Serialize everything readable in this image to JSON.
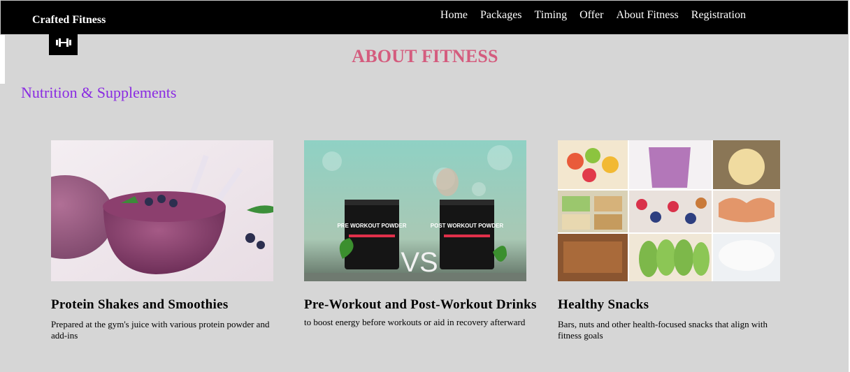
{
  "header": {
    "brand": "Crafted Fitness",
    "logo_icon": "dumbbell-icon",
    "nav": [
      "Home",
      "Packages",
      "Timing",
      "Offer",
      "About Fitness",
      "Registration"
    ]
  },
  "page": {
    "title": "ABOUT FITNESS",
    "section_title": "Nutrition & Supplements"
  },
  "cards": [
    {
      "title": "Protein Shakes and Smoothies",
      "description": "Prepared at the gym's juice with various protein powder and add-ins",
      "image": "purple-smoothie-image"
    },
    {
      "title": "Pre-Workout and Post-Workout Drinks",
      "description": "to boost energy before workouts or aid in recovery afterward",
      "image": "workout-powder-vs-image",
      "image_text": {
        "tub_left_title": "PRE WORKOUT POWDER",
        "tub_right_title": "POST WORKOUT POWDER",
        "vs": "VS"
      }
    },
    {
      "title": "Healthy Snacks",
      "description": "Bars, nuts and other health-focused snacks that align with fitness goals",
      "image": "healthy-snacks-collage-image"
    }
  ],
  "colors": {
    "title": "#d45c7e",
    "section_title": "#8a2be2",
    "background": "#d6d6d6",
    "header": "#000000"
  }
}
